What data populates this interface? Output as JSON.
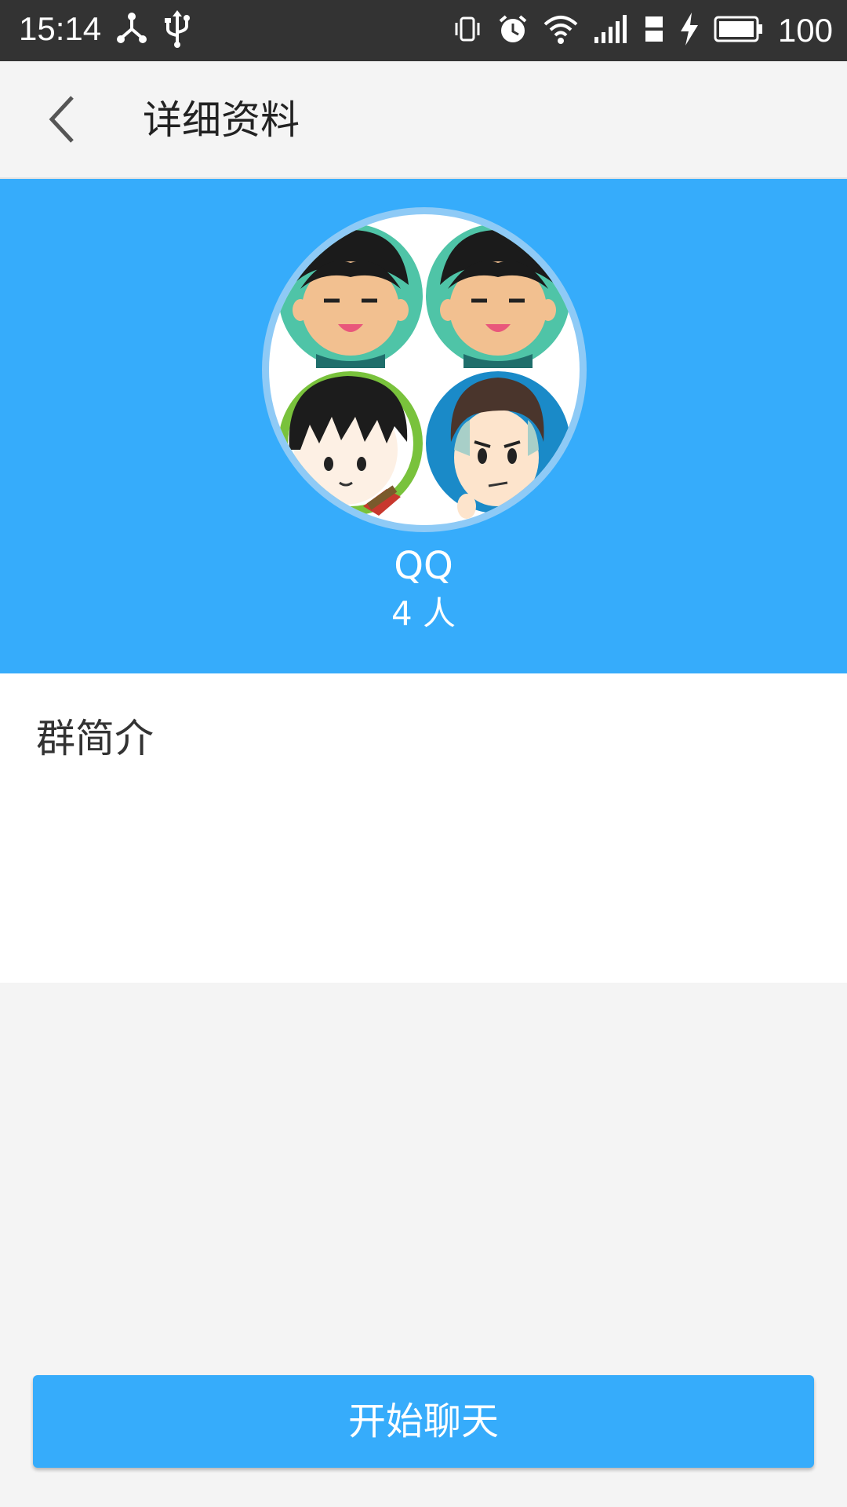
{
  "status_bar": {
    "time": "15:14",
    "battery_level": "100",
    "left_icons": [
      "share-icon",
      "usb-icon"
    ],
    "right_icons": [
      "vibrate-icon",
      "alarm-icon",
      "wifi-icon",
      "signal-icon",
      "4g-lte-icon",
      "charging-icon",
      "battery-icon"
    ]
  },
  "header": {
    "title": "详细资料",
    "back_icon": "chevron-left-icon"
  },
  "group": {
    "name": "QQ",
    "member_count": "4 人"
  },
  "intro": {
    "title": "群简介"
  },
  "actions": {
    "start_chat_label": "开始聊天"
  },
  "colors": {
    "status_bar": "#333333",
    "app_bar": "#f4f4f4",
    "accent": "#36acfb",
    "panel": "#ffffff",
    "page_background": "#f4f4f4"
  }
}
